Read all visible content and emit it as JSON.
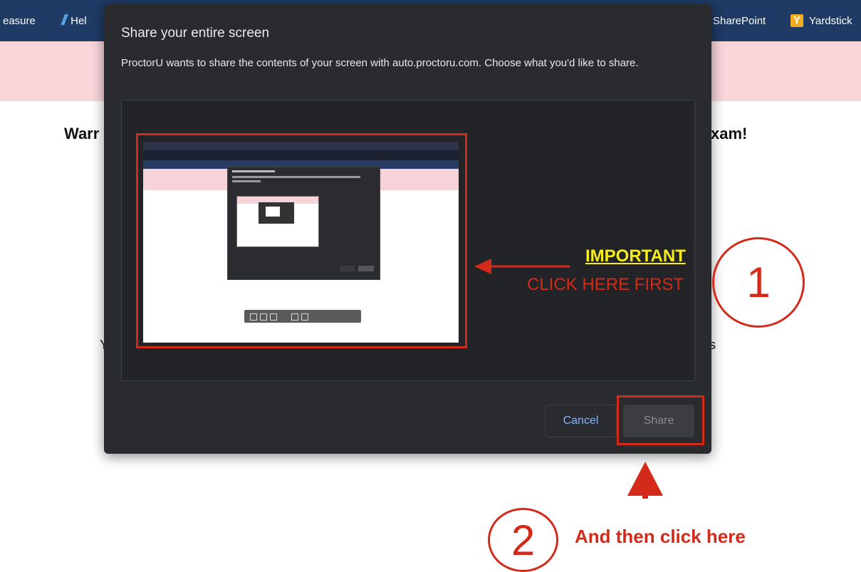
{
  "background_page": {
    "bookmarks": [
      {
        "label": "easure"
      },
      {
        "label": "Hel",
        "icon": "helpdesk-icon"
      },
      {
        "label": "SharePoint"
      },
      {
        "label": "Yardstick",
        "icon": "yardstick-icon",
        "icon_letter": "Y"
      }
    ],
    "heading_left": "Warr",
    "heading_right": "xam!",
    "text_left": "Y",
    "text_right": "s"
  },
  "dialog": {
    "title": "Share your entire screen",
    "description": "ProctorU wants to share the contents of your screen with auto.proctoru.com. Choose what you'd like to share.",
    "cancel_label": "Cancel",
    "share_label": "Share"
  },
  "annotations": {
    "important": "IMPORTANT",
    "click_first": "CLICK HERE FIRST",
    "step1": "1",
    "step2": "2",
    "then_click": "And then click here",
    "color": "#d42a1a",
    "highlight_color": "#f7ec1d"
  }
}
